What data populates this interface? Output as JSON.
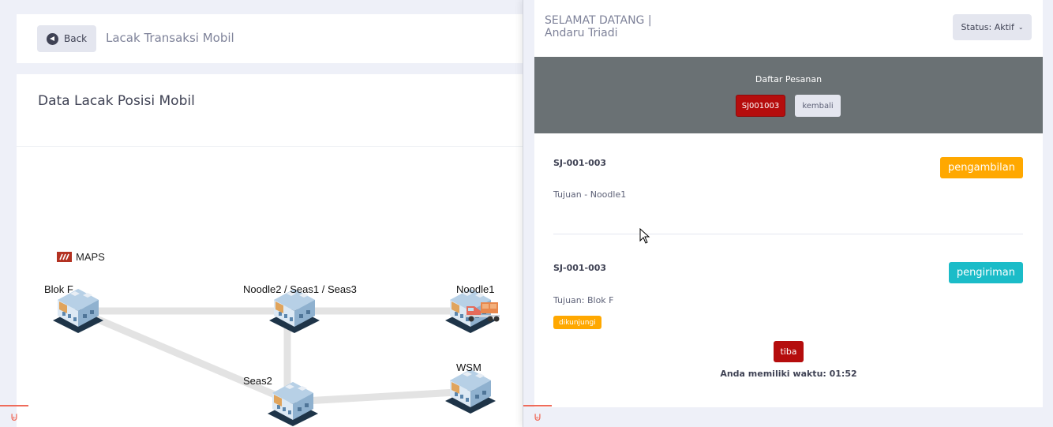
{
  "left": {
    "back_label": "Back",
    "page_title": "Lacak Transaksi Mobil",
    "section_title": "Data Lacak Posisi Mobil",
    "maps_label": "MAPS",
    "nodes": {
      "blokf": "Blok F",
      "noodle2": "Noodle2 / Seas1 / Seas3",
      "noodle1": "Noodle1",
      "seas2": "Seas2",
      "wsm": "WSM"
    }
  },
  "right": {
    "welcome_line1": "SELAMAT DATANG |",
    "welcome_line2": "Andaru Triadi",
    "status_label": "Status: Aktif",
    "daftar_title": "Daftar Pesanan",
    "sj_button": "SJ001003",
    "kembali_button": "kembali",
    "orders": [
      {
        "id": "SJ-001-003",
        "destination": "Tujuan - Noodle1",
        "status": "pengambilan"
      },
      {
        "id": "SJ-001-003",
        "destination": "Tujuan: Blok F",
        "status": "pengiriman",
        "tag": "dikunjungi"
      }
    ],
    "tiba_button": "tiba",
    "timer_text": "Anda memiliki waktu: 01:52"
  },
  "colors": {
    "accent_red": "#b50d0d",
    "orange": "#ffa800",
    "teal": "#1bbcc8",
    "band_gray": "#6a7174"
  }
}
